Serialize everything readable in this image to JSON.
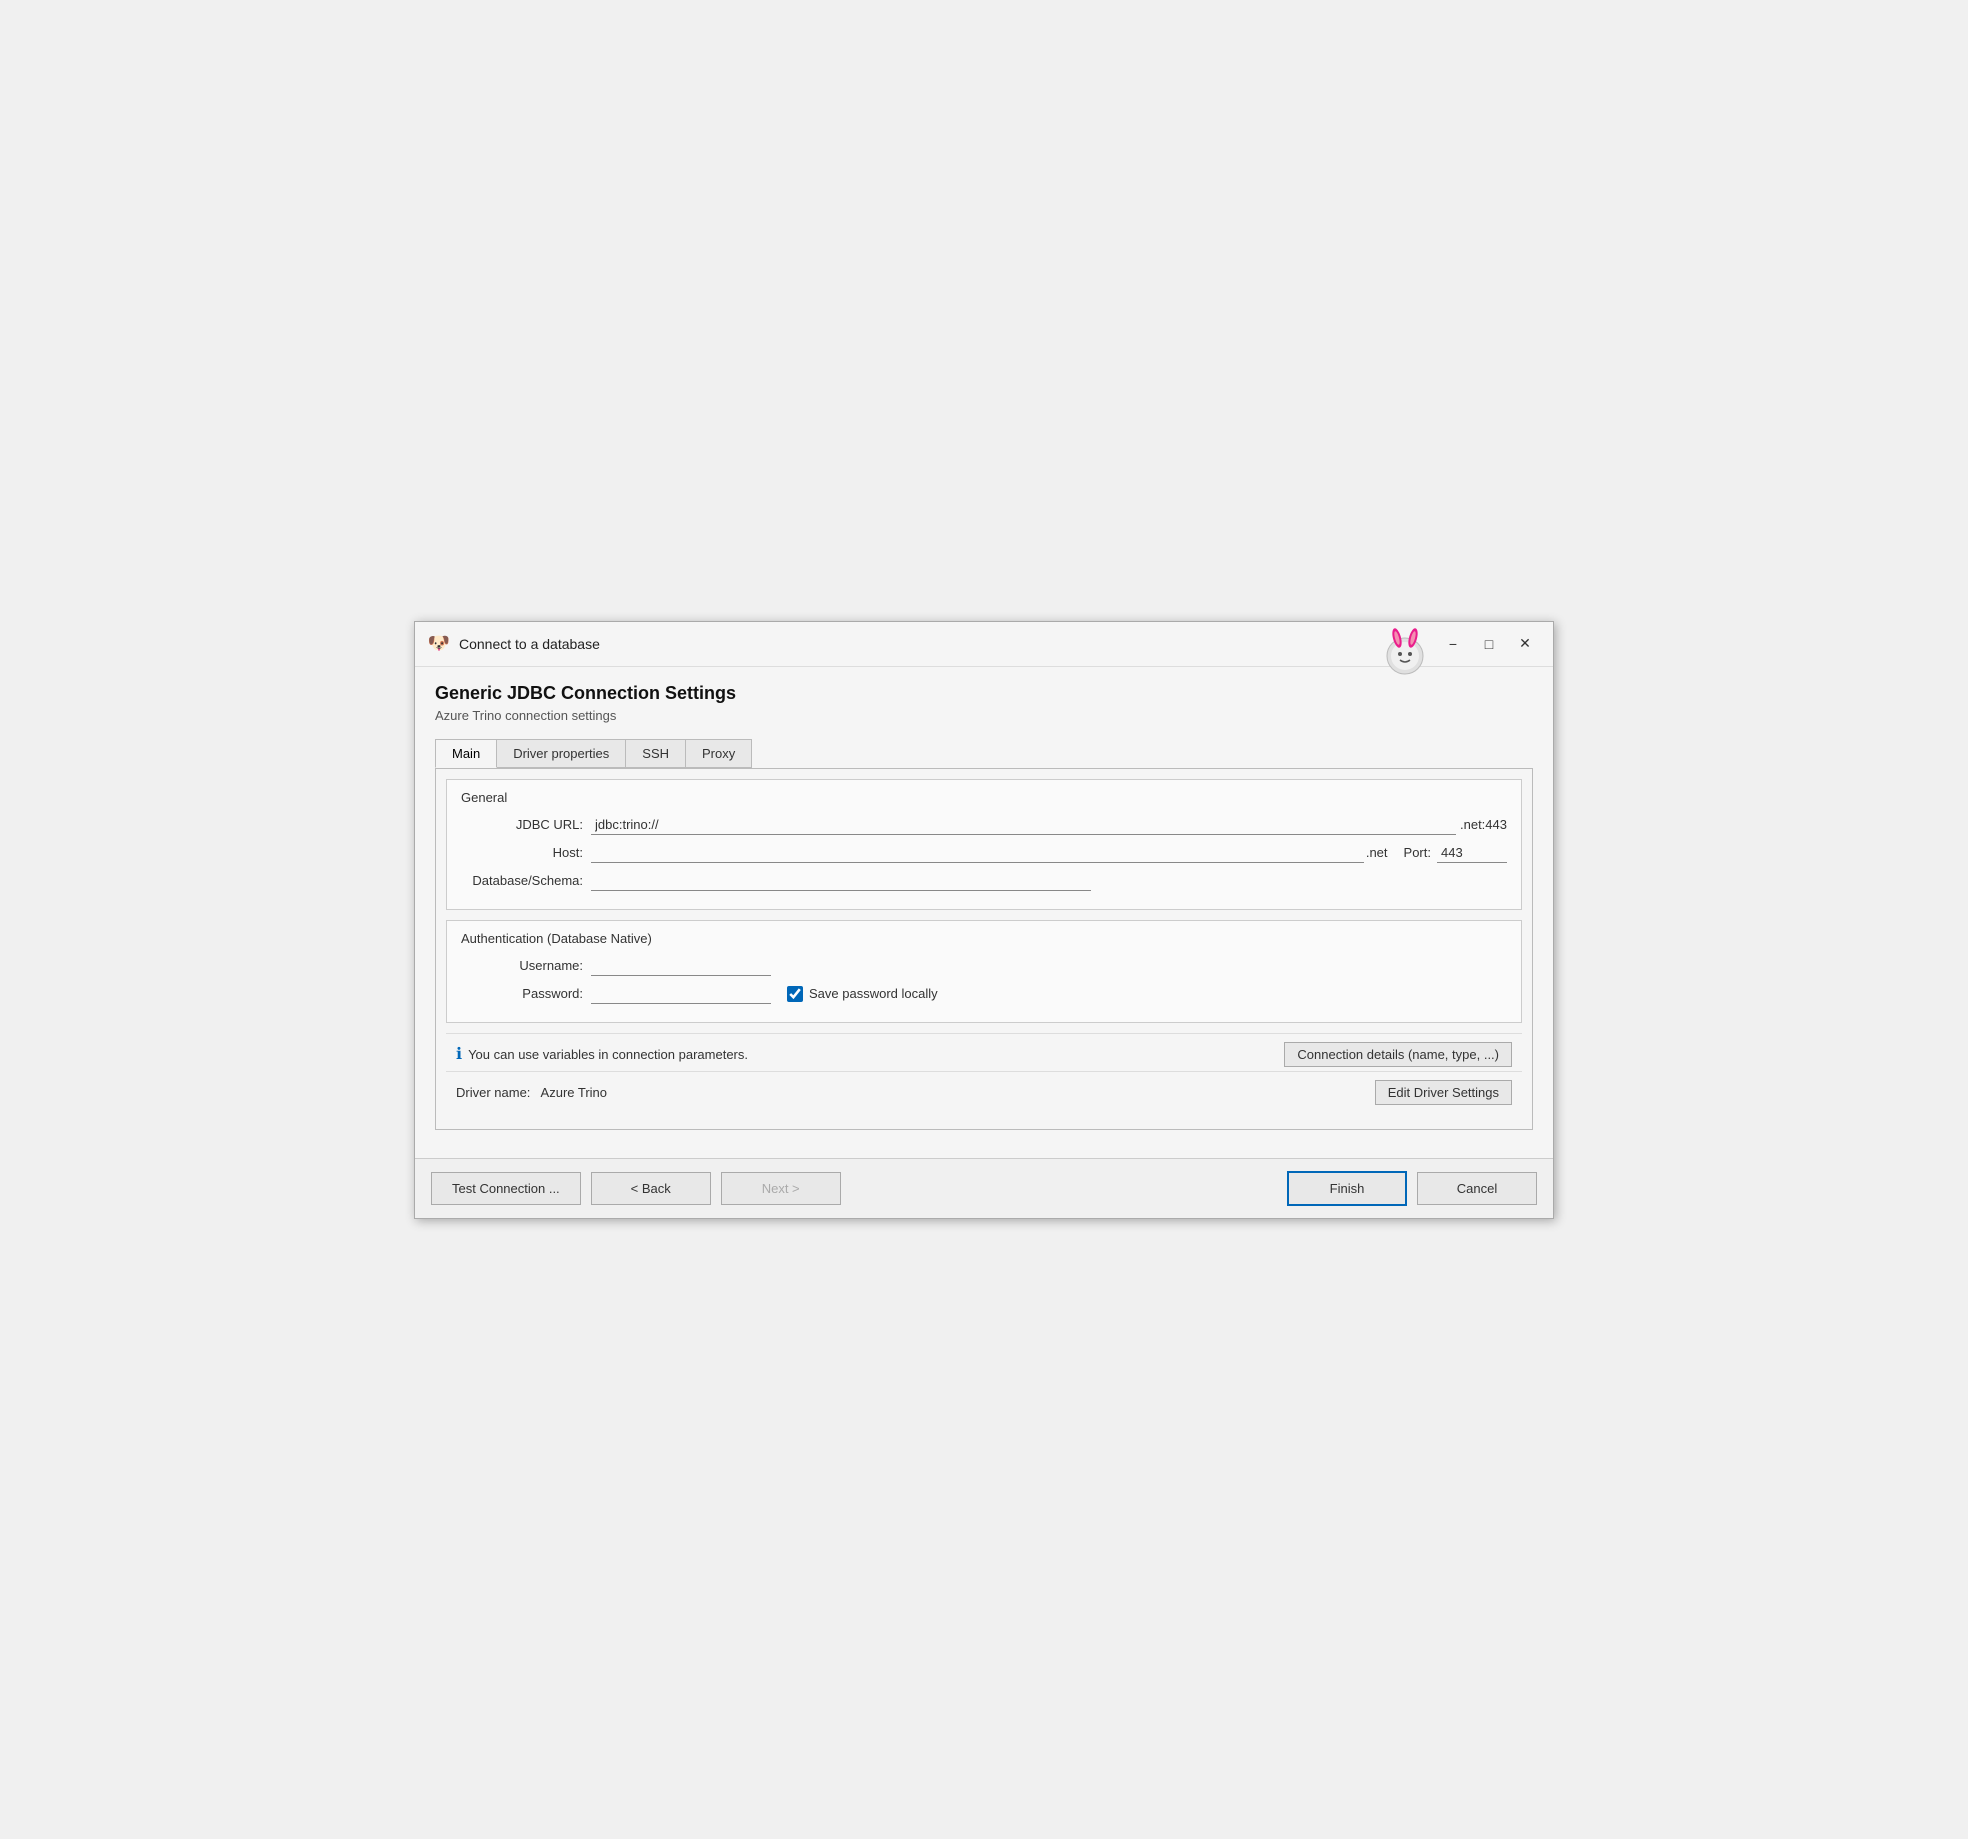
{
  "window": {
    "title": "Connect to a database",
    "minimize_label": "−",
    "maximize_label": "□",
    "close_label": "✕"
  },
  "header": {
    "title": "Generic JDBC Connection Settings",
    "subtitle": "Azure Trino connection settings"
  },
  "tabs": [
    {
      "id": "main",
      "label": "Main",
      "active": true
    },
    {
      "id": "driver-properties",
      "label": "Driver properties",
      "active": false
    },
    {
      "id": "ssh",
      "label": "SSH",
      "active": false
    },
    {
      "id": "proxy",
      "label": "Proxy",
      "active": false
    }
  ],
  "general_section": {
    "title": "General",
    "jdbc_url_label": "JDBC URL:",
    "jdbc_url_value": "jdbc:trino://",
    "jdbc_url_suffix": ".net:443",
    "host_label": "Host:",
    "host_value": "",
    "host_suffix": ".net",
    "port_label": "Port:",
    "port_value": "443",
    "db_label": "Database/Schema:",
    "db_value": ""
  },
  "auth_section": {
    "title": "Authentication (Database Native)",
    "username_label": "Username:",
    "username_value": "",
    "password_label": "Password:",
    "password_value": "",
    "save_password_label": "Save password locally",
    "save_password_checked": true
  },
  "info": {
    "text": "You can use variables in connection parameters.",
    "connection_details_btn": "Connection details (name, type, ...)",
    "driver_name_label": "Driver name:",
    "driver_name_value": "Azure Trino",
    "edit_driver_btn": "Edit Driver Settings"
  },
  "footer": {
    "test_connection_btn": "Test Connection ...",
    "back_btn": "< Back",
    "next_btn": "Next >",
    "finish_btn": "Finish",
    "cancel_btn": "Cancel"
  }
}
